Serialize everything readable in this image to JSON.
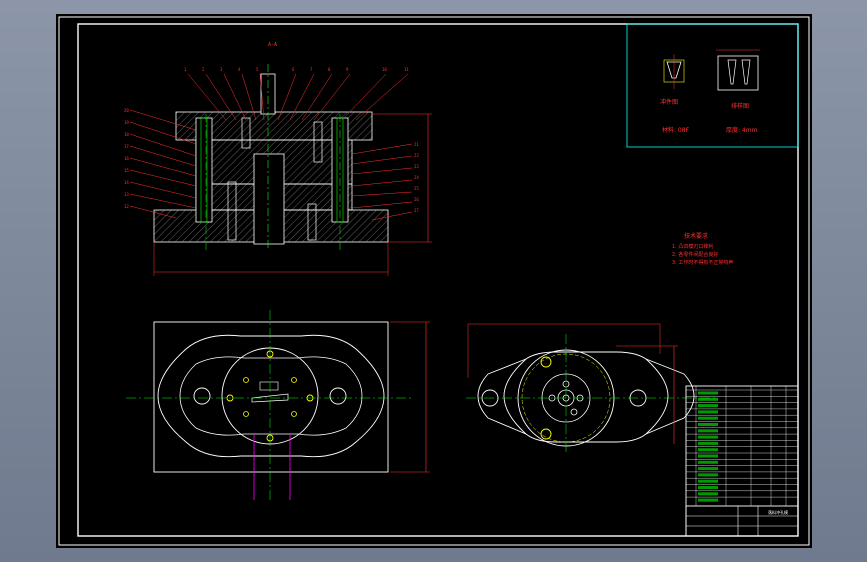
{
  "sheet": {
    "background": "#000000",
    "frame_color": "#ffffff"
  },
  "section_views": {
    "title_mark": "A-A",
    "callouts_left": [
      "20",
      "19",
      "18",
      "17",
      "16",
      "15",
      "14",
      "13",
      "12"
    ],
    "callouts_top": [
      "1",
      "2",
      "3",
      "4",
      "5",
      "6",
      "7",
      "8",
      "9",
      "10",
      "11"
    ],
    "callouts_right": [
      "21",
      "22",
      "23",
      "24",
      "25",
      "26",
      "27"
    ]
  },
  "detail_views": {
    "part_label": "冲件图",
    "strip_label": "排样图",
    "material_note": "材料: 08F",
    "thickness_note": "厚度: 4mm"
  },
  "tech_requirements": {
    "heading": "技术要求",
    "items": [
      "1. 凸凹模刃口锋利",
      "2. 各零件间配合良好",
      "3. 工作时不得有不正常响声"
    ],
    "color": "#ff3030"
  },
  "title_block": {
    "drawing_name": "落料冲孔模",
    "part_rows": 18
  },
  "colors": {
    "outline": "#ffffff",
    "center": "#00ff00",
    "dims": "#ff3030",
    "hidden": "#ffff00",
    "special": "#ff00ff",
    "hatch": "#4a4a4a"
  }
}
